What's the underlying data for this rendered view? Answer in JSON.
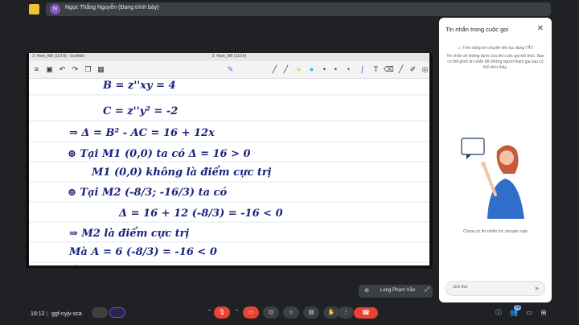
{
  "presenter": {
    "avatar_initial": "N",
    "label": "Ngọc Thắng Nguyễn (Đang trình bày)"
  },
  "shared_window": {
    "title_left": "3. Ham_NB (11/14) - Scribble",
    "title_center": "3. Ham_NB (11/14)",
    "toolbar_icons": [
      "menu-icon",
      "save-icon",
      "undo-icon",
      "redo-icon",
      "copy-icon",
      "image-icon",
      "pen-icon",
      "highlighter-icon",
      "eraser-icon",
      "lasso-icon",
      "shape-icon",
      "text-icon",
      "color-icon",
      "link-icon"
    ],
    "handwriting_lines": [
      "B = z''xy = 4",
      "C = z''y² = -2",
      "⇒ Δ = B² - AC = 16 + 12x",
      "⊛ Tại M1 (0,0) ta có Δ = 16 > 0",
      "M1 (0,0) không là điểm cực trị",
      "⊛ Tại M2 (-8/3; -16/3) ta có",
      "Δ = 16 + 12 (-8/3) = -16 < 0",
      "⇒ M2 là điểm cực trị",
      "Mà A = 6 (-8/3) = -16 < 0",
      "⇒"
    ]
  },
  "chat_panel": {
    "title": "Tin nhắn trong cuộc gọi",
    "setting_label": "Tính năng trò chuyện liên tục đang TẮT",
    "note": "Tin nhắn sẽ không được lưu khi cuộc gọi kết thúc. Bạn có thể ghim tin nhắn để những người tham gia sau có thể nhìn thấy.",
    "empty_text": "Chưa có tin nhắn trò chuyện nào",
    "input_placeholder": "Gửi thư"
  },
  "self_tile": {
    "name": "Long Phạm Văn"
  },
  "bottom_bar": {
    "time": "19:12",
    "separator": "|",
    "meeting_code": "ggf-nyjv-sca",
    "participants_count": "19"
  },
  "colors": {
    "background": "#202124",
    "tile": "#3c4043",
    "danger": "#ea4335",
    "ink": "#1a237e",
    "accent": "#8ab4f8"
  }
}
